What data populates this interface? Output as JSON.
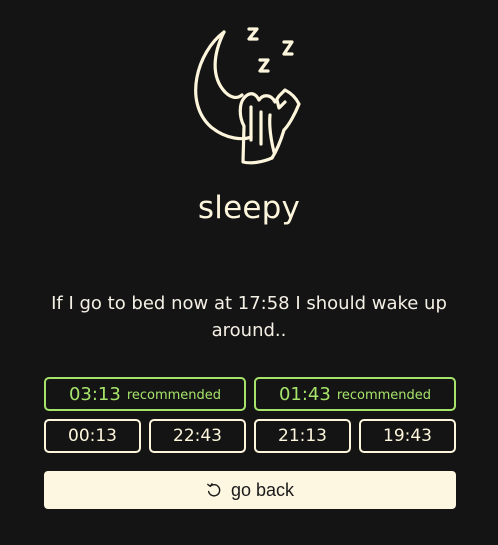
{
  "app": {
    "name": "sleepy"
  },
  "message": "If I go to bed now at 17:58 I should wake up around..",
  "recommended_times": [
    {
      "time": "03:13",
      "tag": "recommended"
    },
    {
      "time": "01:43",
      "tag": "recommended"
    }
  ],
  "other_times": [
    "00:13",
    "22:43",
    "21:13",
    "19:43"
  ],
  "go_back": {
    "label": "go back",
    "icon": "rotate-ccw-icon"
  },
  "colors": {
    "background": "#141414",
    "foreground": "#fdf6dc",
    "recommended": "#a6e36a",
    "button_bg": "#fdf6e0"
  }
}
